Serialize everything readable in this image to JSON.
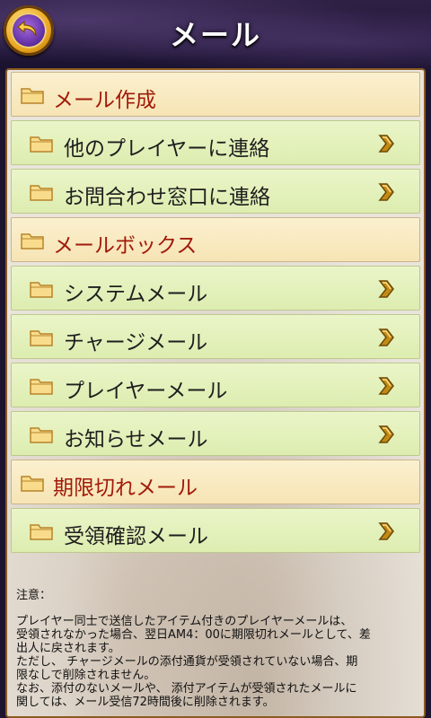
{
  "header": {
    "title": "メール",
    "back_icon": "back-arrow-icon"
  },
  "colors": {
    "category_text": "#a11a0a",
    "item_bg": "#e4f1be",
    "category_bg": "#f8e9c0",
    "frame": "#8a5b22"
  },
  "menu": [
    {
      "type": "category",
      "label": "メール作成"
    },
    {
      "type": "item",
      "label": "他のプレイヤーに連絡"
    },
    {
      "type": "item",
      "label": "お問合わせ窓口に連絡"
    },
    {
      "type": "category",
      "label": "メールボックス"
    },
    {
      "type": "item",
      "label": "システムメール"
    },
    {
      "type": "item",
      "label": "チャージメール"
    },
    {
      "type": "item",
      "label": "プレイヤーメール"
    },
    {
      "type": "item",
      "label": "お知らせメール"
    },
    {
      "type": "category",
      "label": "期限切れメール"
    },
    {
      "type": "item",
      "label": "受領確認メール"
    }
  ],
  "notice": {
    "heading": "注意：",
    "lines": [
      "プレイヤー同士で送信したアイテム付きのプレイヤーメールは、",
      "受領されなかった場合、翌日AM4：00に期限切れメールとして、差",
      "出人に戻されます。",
      "ただし、 チャージメールの添付通貨が受領されていない場合、期",
      "限なしで削除されません。",
      "なお、添付のないメールや、 添付アイテムが受領されたメールに",
      "関しては、メール受信72時間後に削除されます。"
    ]
  }
}
